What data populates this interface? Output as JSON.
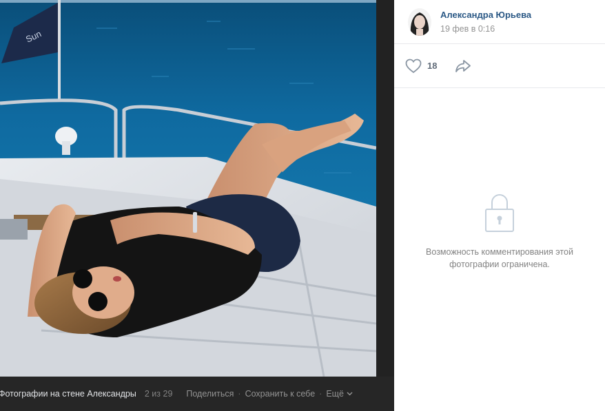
{
  "viewer": {
    "album_title": "Фотографии на стене Александры",
    "counter": "2 из 29",
    "actions": {
      "share": "Поделиться",
      "save": "Сохранить к себе",
      "more": "Ещё"
    },
    "flag_text": "Sun"
  },
  "post": {
    "author": "Александра Юрьева",
    "date": "19 фев в 0:16",
    "likes": "18",
    "comments_locked_text": "Возможность комментирования этой фотографии ограничена."
  },
  "colors": {
    "link": "#2a5885",
    "muted": "#939393",
    "sea": "#0d5a85",
    "dark_bg": "#262626"
  },
  "icons": {
    "like": "heart-icon",
    "share": "share-arrow-icon",
    "lock": "lock-icon",
    "more": "chevron-down-icon"
  }
}
